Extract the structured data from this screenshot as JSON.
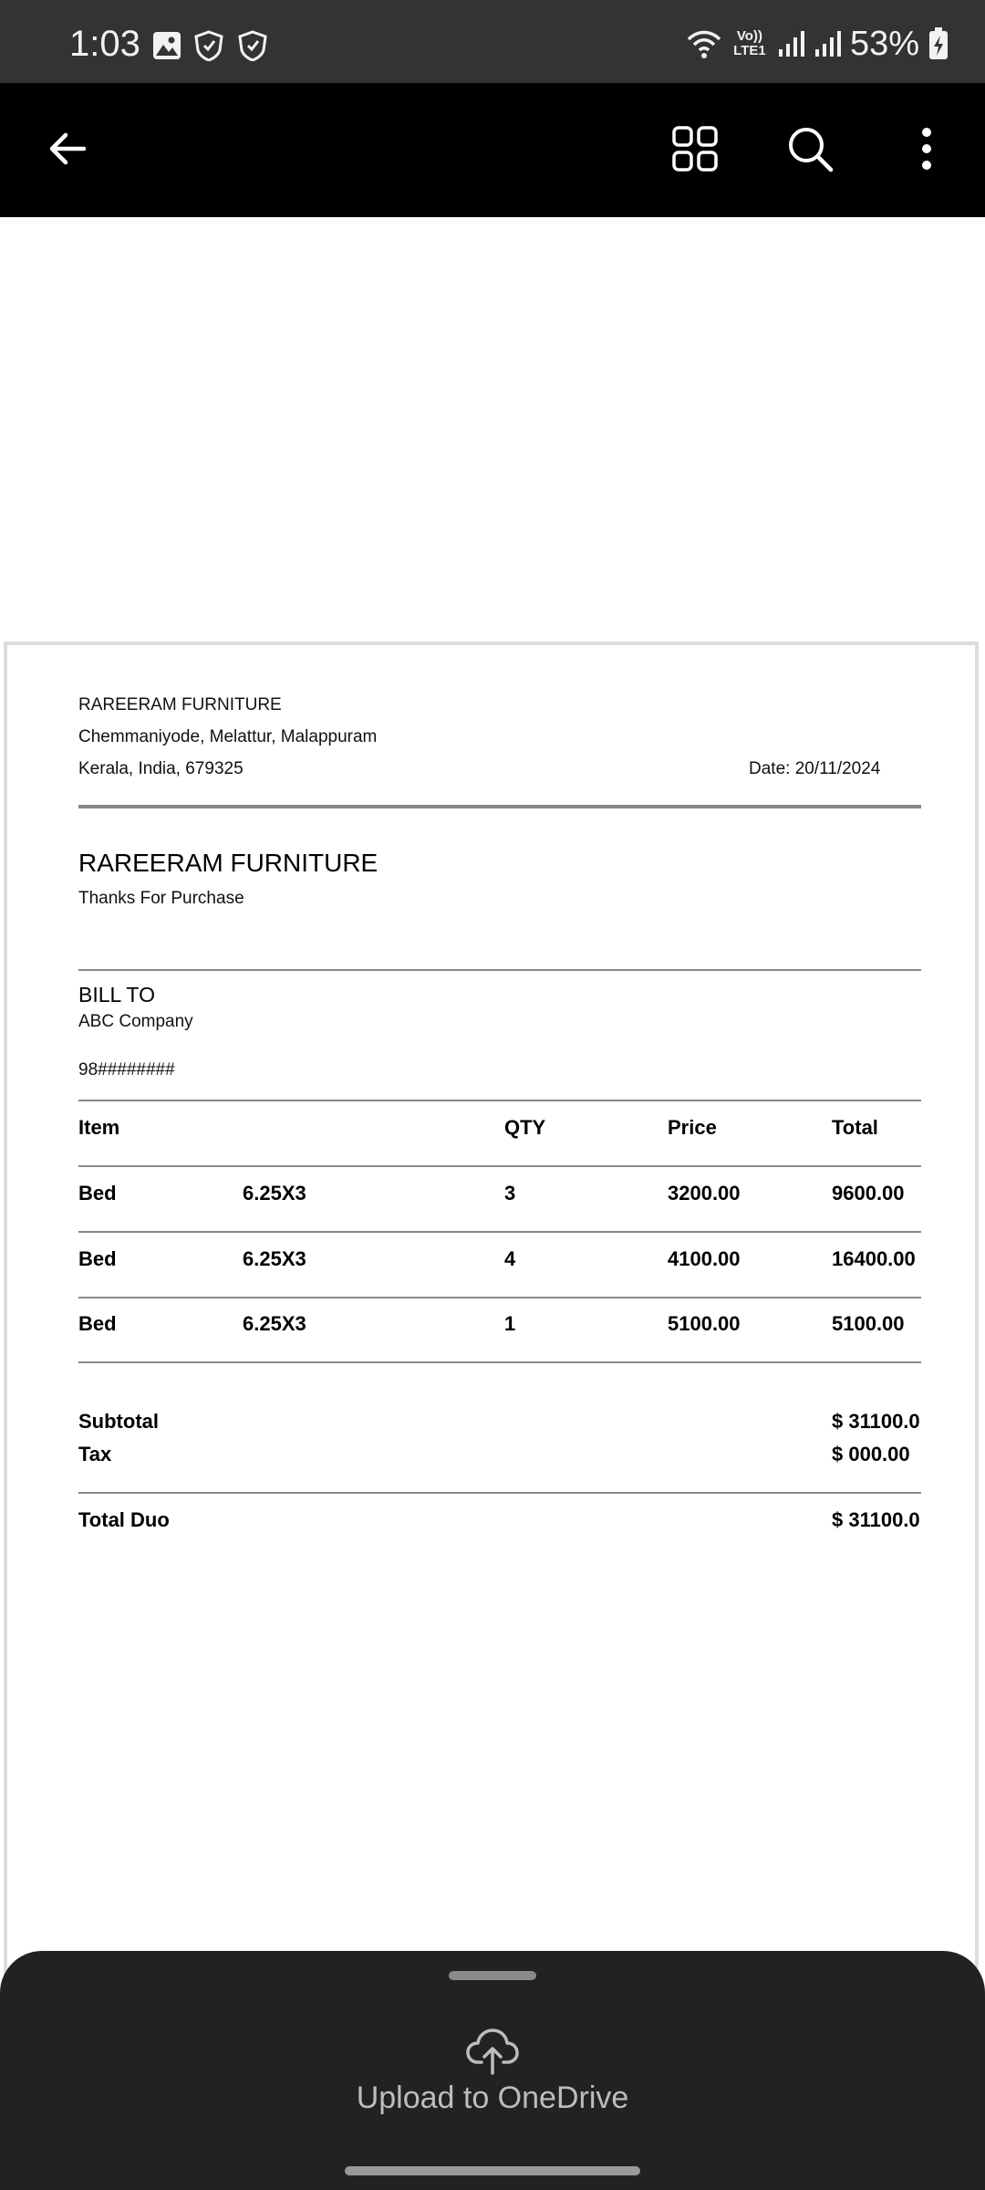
{
  "status_bar": {
    "time": "1:03",
    "battery": "53%",
    "network": "Vo)) LTE1",
    "left_icons": [
      "image-icon",
      "shield-icon",
      "shield-icon"
    ]
  },
  "toolbar": {
    "back_icon": "back-arrow-icon",
    "grid_icon": "grid-view-icon",
    "search_icon": "search-icon",
    "more_icon": "more-vertical-icon"
  },
  "document": {
    "company_name_small": "RAREERAM FURNITURE",
    "address_line1": "Chemmaniyode, Melattur, Malappuram",
    "address_line2": "Kerala, India, 679325",
    "date": "Date: 20/11/2024",
    "company_name": "RAREERAM FURNITURE",
    "tagline": "Thanks For Purchase",
    "bill_to_label": "BILL TO",
    "bill_to_name": "ABC Company",
    "bill_to_phone": "98########",
    "table": {
      "headers": [
        "Item",
        "",
        "QTY",
        "Price",
        "Total"
      ],
      "rows": [
        [
          "Bed",
          "6.25X3",
          "3",
          "3200.00",
          "9600.00"
        ],
        [
          "Bed",
          "6.25X3",
          "4",
          "4100.00",
          "16400.00"
        ],
        [
          "Bed",
          "6.25X3",
          "1",
          "5100.00",
          "5100.00"
        ]
      ]
    },
    "subtotal_label": "Subtotal",
    "subtotal_value": "$ 31100.0",
    "tax_label": "Tax",
    "tax_value": "$ 000.00",
    "total_label": "Total Duo",
    "total_value": "$ 31100.0"
  },
  "bottom_sheet": {
    "upload_icon": "cloud-upload-icon",
    "upload_label": "Upload to OneDrive"
  }
}
